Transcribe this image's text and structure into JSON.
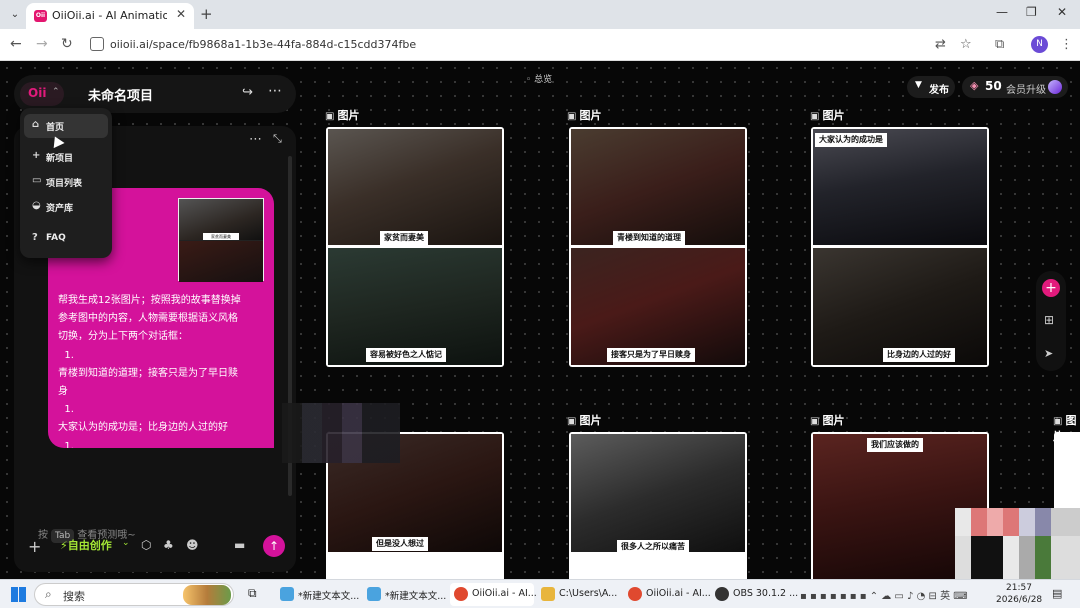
{
  "browser": {
    "tab_title": "OiiOii.ai - AI Animation agen",
    "favicon_text": "Oii",
    "url": "oiioii.ai/space/fb9868a1-1b3e-44fa-884d-c15cdd374fbe",
    "profile_initial": "N"
  },
  "app": {
    "logo": "Oii",
    "project_title": "未命名项目",
    "overview_label": "总览",
    "publish_label": "发布",
    "credits": "50",
    "upgrade_label": "会员升级",
    "accent_color": "#d4129b"
  },
  "nav_menu": [
    {
      "icon": "home-icon",
      "label": "首页"
    },
    {
      "icon": "plus-icon",
      "label": "新项目"
    },
    {
      "icon": "folder-icon",
      "label": "项目列表"
    },
    {
      "icon": "asset-icon",
      "label": "资产库"
    },
    {
      "icon": "help-icon",
      "label": "FAQ"
    }
  ],
  "chat": {
    "thumb_caption": "家贫而妻美",
    "message_lines": [
      "帮我生成12张图片；按照我的故事替换掉",
      "参考图中的内容，人物需要根据语义风格",
      "切换，分为上下两个对话框：",
      "  1.",
      "青楼到知道的道理；接客只是为了早日赎",
      "身",
      "  1.",
      "大家认为的成功是；比身边的人过的好",
      "  1."
    ],
    "input_prefix": "按",
    "input_key": "Tab",
    "input_placeholder": "查看预测哦~",
    "mode_label": "自由创作"
  },
  "cards": [
    {
      "header": "图片",
      "top_caption": "",
      "caption_1": "家贫而妻美",
      "caption_2": "容易被好色之人惦记"
    },
    {
      "header": "图片",
      "top_caption": "",
      "caption_1": "青楼到知道的道理",
      "caption_2": "接客只是为了早日赎身"
    },
    {
      "header": "图片",
      "top_caption": "大家认为的成功是",
      "caption_1": "",
      "caption_2": "比身边的人过的好"
    },
    {
      "header": "",
      "top_caption": "",
      "caption_1": "但是没人想过",
      "caption_2": ""
    },
    {
      "header": "图片",
      "top_caption": "",
      "caption_1": "很多人之所以痛苦",
      "caption_2": ""
    },
    {
      "header": "图片",
      "top_caption": "我们应该做的",
      "caption_1": "",
      "caption_2": ""
    }
  ],
  "partial_card_header": "图片",
  "taskbar": {
    "search_text": "搜索",
    "items": [
      {
        "label": "*新建文本文...",
        "color": "#4aa3df"
      },
      {
        "label": "*新建文本文...",
        "color": "#4aa3df"
      },
      {
        "label": "OiiOii.ai - AI...",
        "color": "#e0492f"
      },
      {
        "label": "C:\\Users\\A...",
        "color": "#e8b53c"
      },
      {
        "label": "OiiOii.ai - AI...",
        "color": "#e0492f"
      },
      {
        "label": "OBS 30.1.2 ...",
        "color": "#333333"
      }
    ],
    "ime_label": "英",
    "time": "21:57",
    "date": "2026/6/28"
  }
}
